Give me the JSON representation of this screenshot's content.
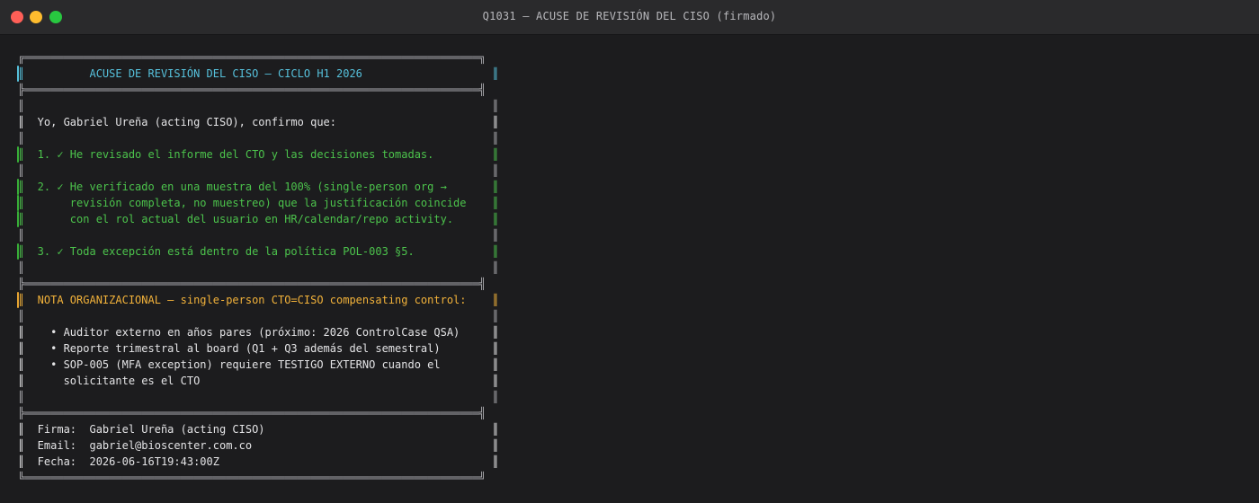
{
  "window": {
    "title": "Q1031 — ACUSE DE REVISIÓN DEL CISO (firmado)"
  },
  "colors": {
    "frame": "#a9a9ad",
    "header": "#56c1dc",
    "checked": "#4cc34c",
    "text": "#e4e4e6",
    "note": "#f2b23a",
    "background": "#1c1c1e"
  },
  "document": {
    "rule_top": "╔══════════════════════════════════════════════════════════════════════╗",
    "header": "║          ACUSE DE REVISIÓN DEL CISO — CICLO H1 2026                    ║",
    "rule_header_bottom": "╠══════════════════════════════════════════════════════════════════════╣",
    "blank": "║                                                                        ║",
    "intro": "║  Yo, Gabriel Ureña (acting CISO), confirmo que:                        ║",
    "item1": "║  1. ✓ He revisado el informe del CTO y las decisiones tomadas.         ║",
    "item2_line1": "║  2. ✓ He verificado en una muestra del 100% (single‑person org →       ║",
    "item2_line2": "║       revisión completa, no muestreo) que la justificación coincide    ║",
    "item2_line3": "║       con el rol actual del usuario en HR/calendar/repo activity.      ║",
    "item3": "║  3. ✓ Toda excepción está dentro de la política POL‑003 §5.            ║",
    "rule_middle": "╠══════════════════════════════════════════════════════════════════════╣",
    "note_title": "║  NOTA ORGANIZACIONAL — single‑person CTO=CISO compensating control:    ║",
    "note_b1": "║    • Auditor externo en años pares (próximo: 2026 ControlCase QSA)     ║",
    "note_b2": "║    • Reporte trimestral al board (Q1 + Q3 además del semestral)        ║",
    "note_b3_line1": "║    • SOP‑005 (MFA exception) requiere TESTIGO EXTERNO cuando el        ║",
    "note_b3_line2": "║      solicitante es el CTO                                             ║",
    "rule_sign": "╠══════════════════════════════════════════════════════════════════════╣",
    "firma": "║  Firma:  Gabriel Ureña (acting CISO)                                   ║",
    "email": "║  Email:  gabriel@bioscenter.com.co                                     ║",
    "fecha": "║  Fecha:  2026‑06‑16T19:43:00Z                                          ║",
    "rule_bottom": "╚══════════════════════════════════════════════════════════════════════╝"
  }
}
